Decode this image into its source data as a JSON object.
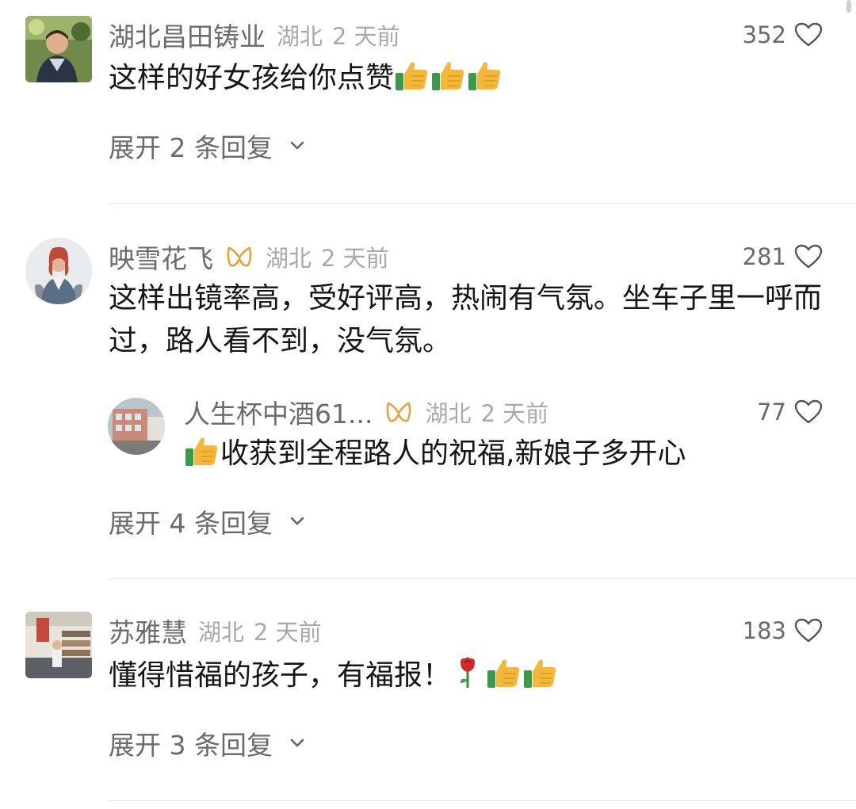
{
  "comments": [
    {
      "name": "湖北昌田铸业",
      "location": "湖北",
      "time": "2 天前",
      "likes": "352",
      "text": "这样的好女孩给你点赞",
      "emoji_count": 3,
      "expand": "展开 2 条回复"
    },
    {
      "name": "映雪花飞",
      "location": "湖北",
      "time": "2 天前",
      "likes": "281",
      "text": "这样出镜率高，受好评高，热闹有气氛。坐车子里一呼而过，路人看不到，没气氛。",
      "reply": {
        "name": "人生杯中酒61...",
        "location": "湖北",
        "time": "2 天前",
        "likes": "77",
        "text": "收获到全程路人的祝福,新娘子多开心"
      },
      "expand": "展开 4 条回复"
    },
    {
      "name": "苏雅慧",
      "location": "湖北",
      "time": "2 天前",
      "likes": "183",
      "text": "懂得惜福的孩子，有福报！",
      "expand": "展开 3 条回复"
    }
  ],
  "colors": {
    "name": "#6b6b6b",
    "meta": "#a9a9a9",
    "text": "#161616",
    "badge": "#e8a23a",
    "divider": "#e8e8e8"
  },
  "icons": [
    "heart-outline-icon",
    "chevron-down-icon",
    "thumbs-up-emoji",
    "rose-emoji",
    "fan-badge-icon"
  ]
}
